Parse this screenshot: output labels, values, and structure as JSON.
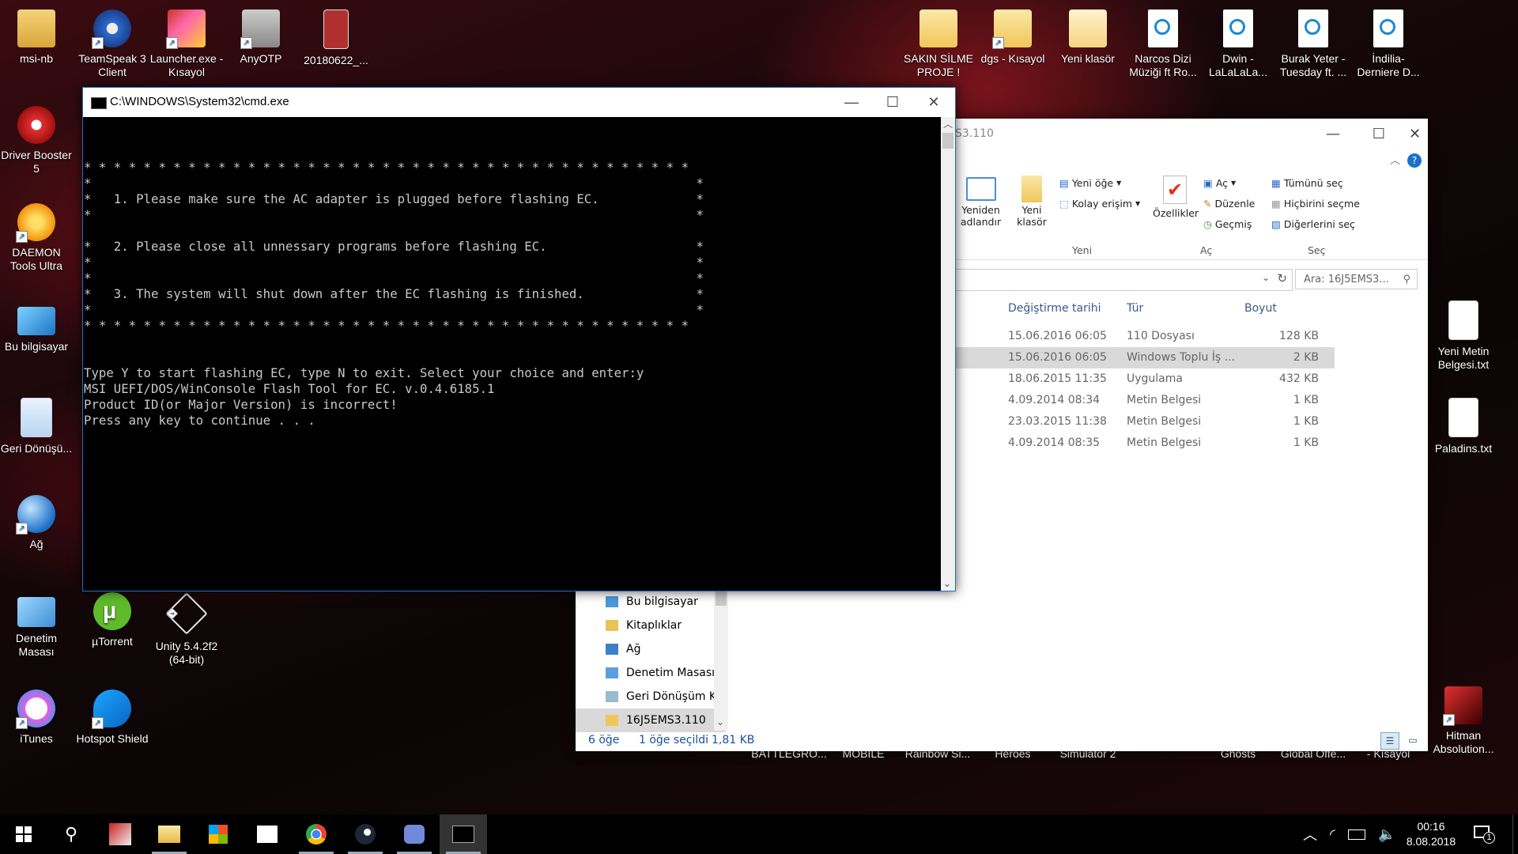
{
  "desktop_icons": [
    {
      "key": "msi",
      "label": "msi-nb"
    },
    {
      "key": "ts",
      "label": "TeamSpeak 3 Client"
    },
    {
      "key": "launcher",
      "label": "Launcher.exe - Kısayol"
    },
    {
      "key": "anyotp",
      "label": "AnyOTP"
    },
    {
      "key": "file2018",
      "label": "20180622_..."
    },
    {
      "key": "sakin",
      "label": "SAKIN SİLME PROJE !"
    },
    {
      "key": "dgs",
      "label": "dgs - Kısayol"
    },
    {
      "key": "yeni",
      "label": "Yeni klasör"
    },
    {
      "key": "narcos",
      "label": "Narcos Dizi Müziği ft Ro..."
    },
    {
      "key": "dwin",
      "label": "Dwin - LaLaLaLa..."
    },
    {
      "key": "burak",
      "label": "Burak Yeter - Tuesday ft. ..."
    },
    {
      "key": "indilia",
      "label": "İndilia- Derniere D..."
    },
    {
      "key": "driver",
      "label": "Driver Booster 5"
    },
    {
      "key": "daemon",
      "label": "DAEMON Tools Ultra"
    },
    {
      "key": "pc",
      "label": "Bu bilgisayar"
    },
    {
      "key": "recycle",
      "label": "Geri Dönüşü..."
    },
    {
      "key": "network",
      "label": "Ağ"
    },
    {
      "key": "control",
      "label": "Denetim Masası"
    },
    {
      "key": "utorrent",
      "label": "µTorrent"
    },
    {
      "key": "unity",
      "label": "Unity 5.4.2f2 (64-bit)"
    },
    {
      "key": "itunes",
      "label": "iTunes"
    },
    {
      "key": "hotspot",
      "label": "Hotspot Shield"
    },
    {
      "key": "yenimetin",
      "label": "Yeni Metin Belgesi.txt"
    },
    {
      "key": "paladins",
      "label": "Paladins.txt"
    },
    {
      "key": "hitman",
      "label": "Hitman Absolution..."
    }
  ],
  "hidden_labels": [
    "BATTLEGRO...",
    "MOBILE",
    "Rainbow Si...",
    "Heroes",
    "Simulator 2",
    "Ghosts",
    "Global Offe...",
    "- Kısayol"
  ],
  "cmd": {
    "title": "C:\\WINDOWS\\System32\\cmd.exe",
    "lines": [
      "",
      "* * * * * * * * * * * * * * * * * * * * * * * * * * * * * * * * * * * * * * * * *",
      "*                                                                                 *",
      "*   1. Please make sure the AC adapter is plugged before flashing EC.             *",
      "*                                                                                 *",
      "",
      "*   2. Please close all unnessary programs before flashing EC.                    *",
      "*                                                                                 *",
      "*                                                                                 *",
      "*   3. The system will shut down after the EC flashing is finished.               *",
      "*                                                                                 *",
      "* * * * * * * * * * * * * * * * * * * * * * * * * * * * * * * * * * * * * * * * *",
      "",
      "",
      "Type Y to start flashing EC, type N to exit. Select your choice and enter:y",
      "MSI UEFI/DOS/WinConsole Flash Tool for EC. v.0.4.6185.1",
      "Product ID(or Major Version) is incorrect!",
      "Press any key to continue . . ."
    ]
  },
  "explorer": {
    "title_fragment": "S3.110",
    "ribbon": {
      "rename": "Yeniden adlandır",
      "new_folder": "Yeni klasör",
      "new_item": "Yeni öğe",
      "easy_access": "Kolay erişim",
      "group_new": "Yeni",
      "properties": "Özellikler",
      "open": "Aç",
      "edit": "Düzenle",
      "history": "Geçmiş",
      "group_open": "Aç",
      "select_all": "Tümünü seç",
      "select_none": "Hiçbirini seçme",
      "invert": "Diğerlerini seç",
      "group_select": "Seç"
    },
    "search_placeholder": "Ara: 16J5EMS3...",
    "columns": {
      "date": "Değiştirme tarihi",
      "type": "Tür",
      "size": "Boyut"
    },
    "rows": [
      {
        "date": "15.06.2016 06:05",
        "type": "110 Dosyası",
        "size": "128 KB"
      },
      {
        "date": "15.06.2016 06:05",
        "type": "Windows Toplu İş ...",
        "size": "2 KB"
      },
      {
        "date": "18.06.2015 11:35",
        "type": "Uygulama",
        "size": "432 KB"
      },
      {
        "date": "4.09.2014 08:34",
        "type": "Metin Belgesi",
        "size": "1 KB"
      },
      {
        "date": "23.03.2015 11:38",
        "type": "Metin Belgesi",
        "size": "1 KB"
      },
      {
        "date": "4.09.2014 08:35",
        "type": "Metin Belgesi",
        "size": "1 KB"
      }
    ],
    "nav": [
      "Bu bilgisayar",
      "Kitaplıklar",
      "Ağ",
      "Denetim Masası",
      "Geri Dönüşüm Kı",
      "16J5EMS3.110"
    ],
    "status": {
      "count": "6 öğe",
      "selected": "1 öğe seçildi",
      "size": "1,81 KB"
    }
  },
  "taskbar": {
    "time": "00:16",
    "date": "8.08.2018",
    "notif_count": "1"
  }
}
